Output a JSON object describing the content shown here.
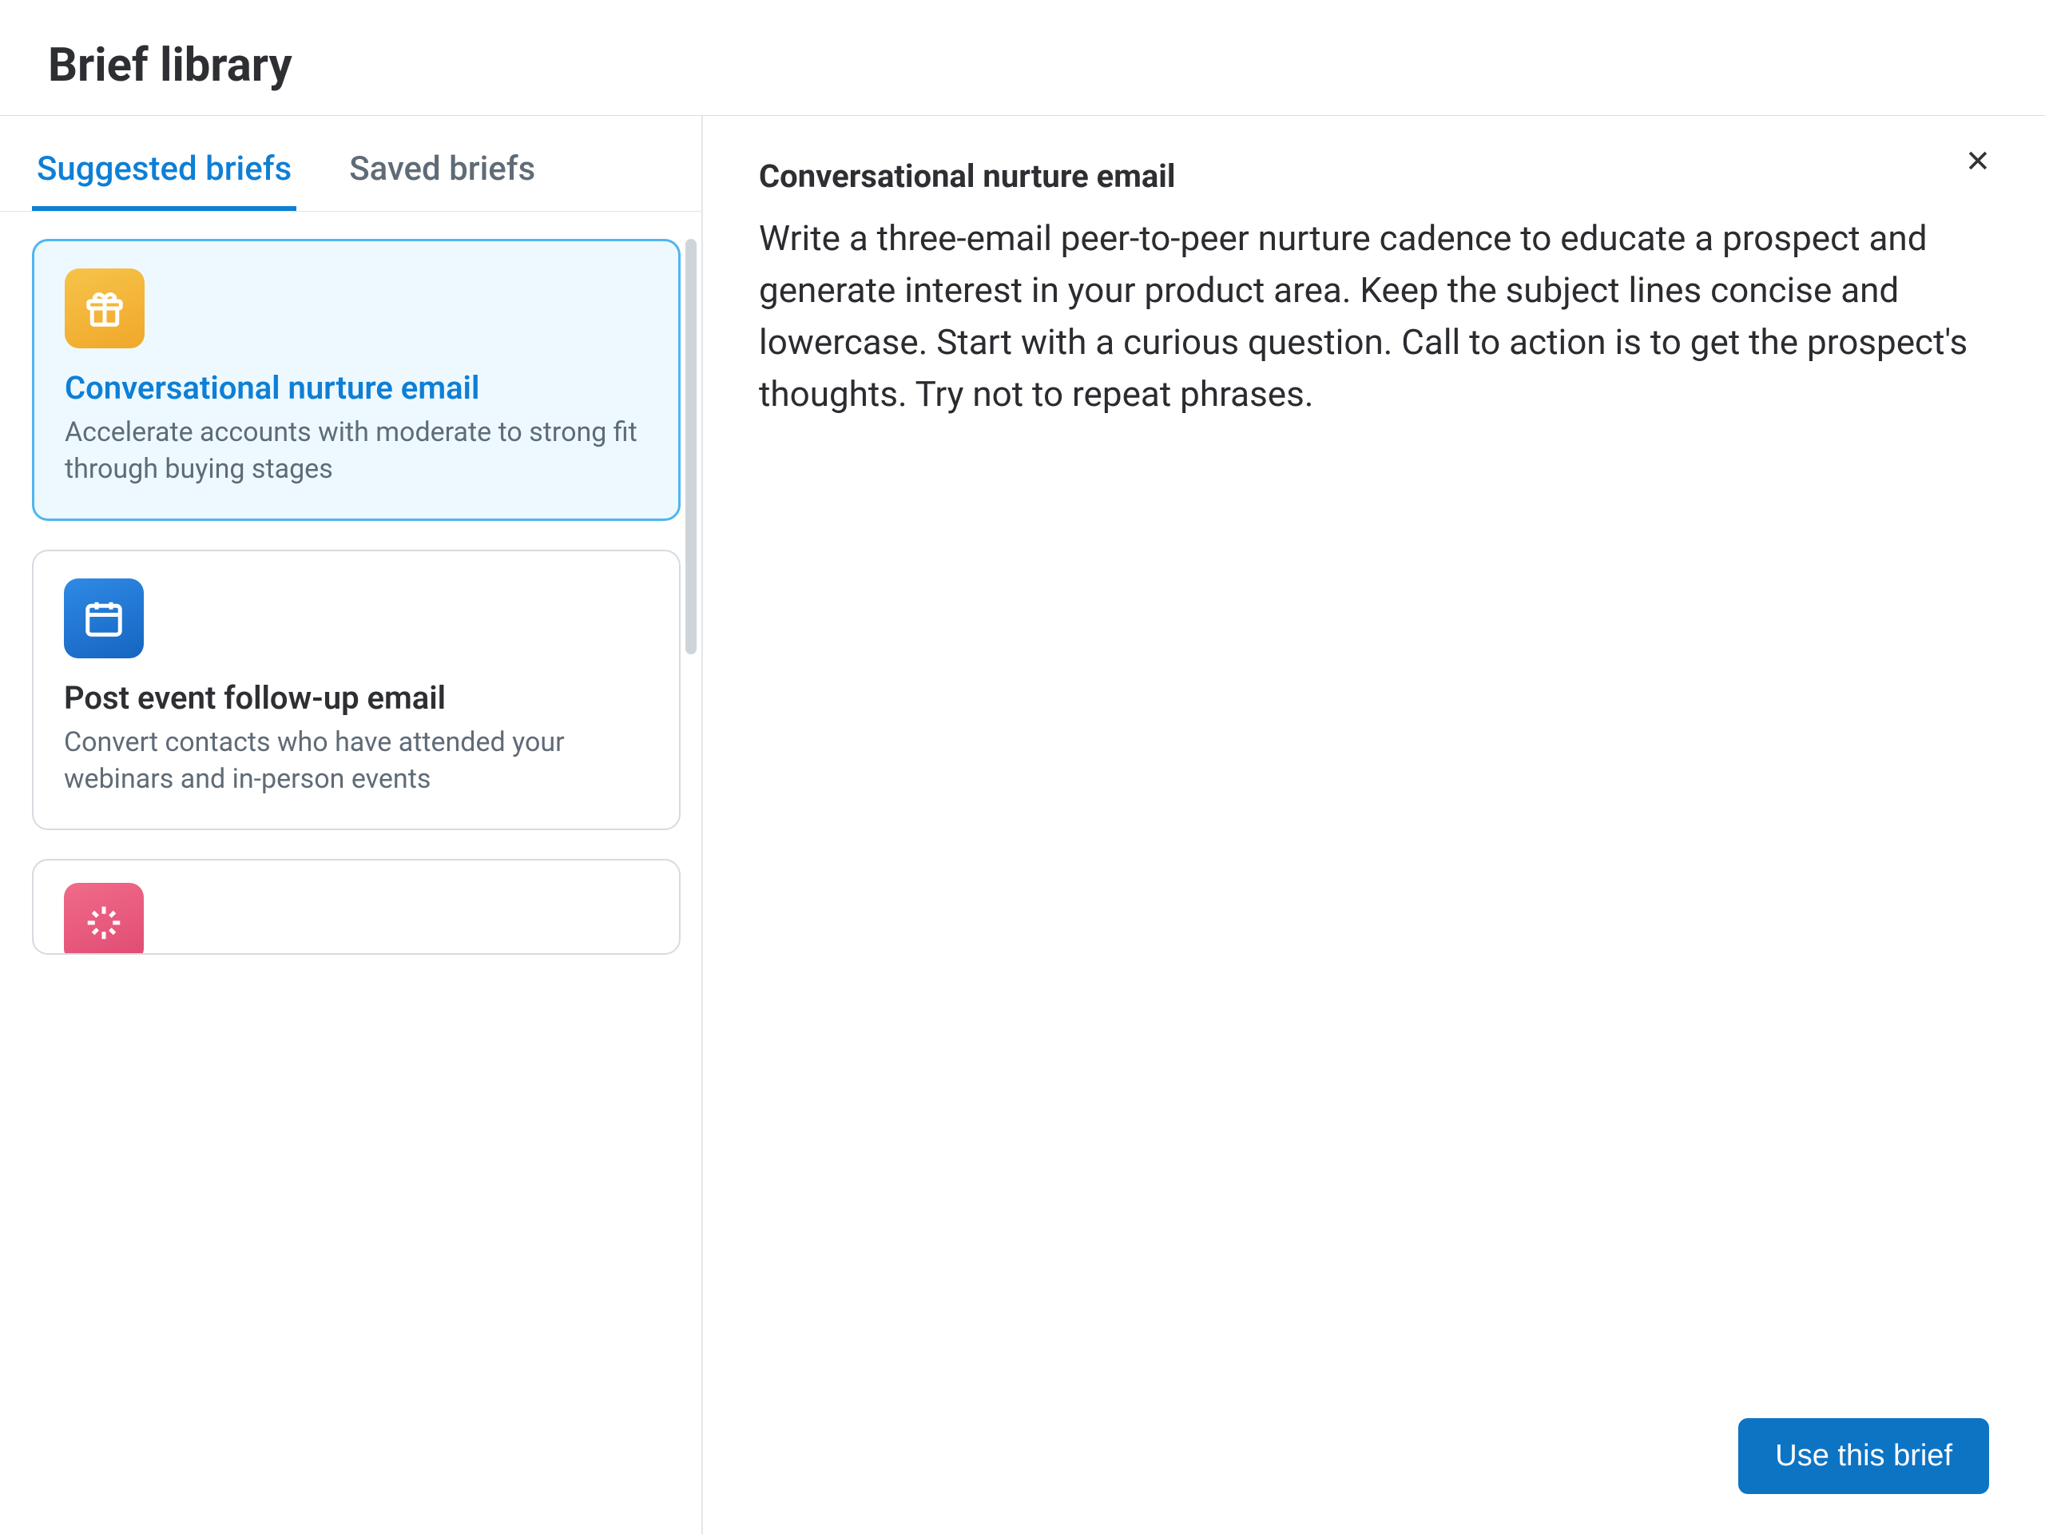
{
  "page": {
    "title": "Brief library"
  },
  "tabs": {
    "suggested": "Suggested briefs",
    "saved": "Saved briefs",
    "active": "suggested"
  },
  "briefs": [
    {
      "icon": "gift-icon",
      "iconColor": "amber",
      "title": "Conversational nurture email",
      "desc": "Accelerate accounts with moderate to strong fit through buying stages",
      "selected": true
    },
    {
      "icon": "calendar-icon",
      "iconColor": "blue",
      "title": "Post event follow-up email",
      "desc": "Convert contacts who have attended your webinars and in-person events",
      "selected": false
    },
    {
      "icon": "sparkle-icon",
      "iconColor": "pink",
      "title": "",
      "desc": "",
      "selected": false
    }
  ],
  "detail": {
    "title": "Conversational nurture email",
    "body": "Write a three-email peer-to-peer nurture cadence to educate a prospect and generate interest in your product area. Keep the subject lines concise and lowercase. Start with a curious question. Call to action is to get the prospect's thoughts. Try not to repeat phrases."
  },
  "actions": {
    "useBrief": "Use this brief"
  }
}
